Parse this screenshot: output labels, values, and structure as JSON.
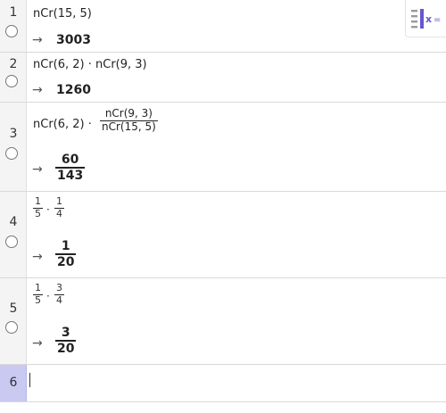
{
  "rows": [
    {
      "number": "1",
      "input": "nCr(15, 5)",
      "result": "3003"
    },
    {
      "number": "2",
      "input": "nCr(6, 2) · nCr(9, 3)",
      "result": "1260"
    },
    {
      "number": "3",
      "input_prefix": "nCr(6, 2) ·",
      "input_num": "nCr(9, 3)",
      "input_den": "nCr(15, 5)",
      "result_num": "60",
      "result_den": "143"
    },
    {
      "number": "4",
      "f1_num": "1",
      "f1_den": "5",
      "f2_num": "1",
      "f2_den": "4",
      "dot": "·",
      "result_num": "1",
      "result_den": "20"
    },
    {
      "number": "5",
      "f1_num": "1",
      "f1_den": "5",
      "f2_num": "3",
      "f2_den": "4",
      "dot": "·",
      "result_num": "3",
      "result_den": "20"
    },
    {
      "number": "6",
      "input": ""
    }
  ],
  "arrow_symbol": "→",
  "keyboard_toggle_icon": "algebra-keyboard-icon",
  "colors": {
    "active_gutter": "#c9c9f2",
    "toggle_accent": "#6557d2"
  }
}
